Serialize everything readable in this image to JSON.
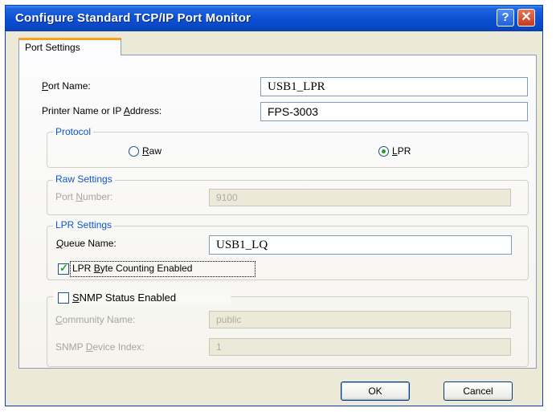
{
  "window": {
    "title": "Configure Standard TCP/IP Port Monitor",
    "help_label": "?",
    "close_label": "✕"
  },
  "tabs": [
    {
      "label": "Port Settings",
      "selected": true
    }
  ],
  "form": {
    "port_name": {
      "label_ul": "P",
      "label_rest": "ort Name:",
      "value": "USB1_LPR"
    },
    "printer": {
      "label_pre": "Printer Name or IP ",
      "label_ul": "A",
      "label_rest": "ddress:",
      "value": "FPS-3003"
    }
  },
  "protocol": {
    "legend": "Protocol",
    "raw": {
      "label_ul": "R",
      "label_rest": "aw",
      "selected": false
    },
    "lpr": {
      "label_ul": "L",
      "label_rest": "PR",
      "selected": true
    }
  },
  "raw_settings": {
    "legend": "Raw Settings",
    "port_number": {
      "label_pre": "Port ",
      "label_ul": "N",
      "label_rest": "umber:",
      "value": "9100"
    }
  },
  "lpr_settings": {
    "legend": "LPR Settings",
    "queue_name": {
      "label_ul": "Q",
      "label_rest": "ueue Name:",
      "value": "USB1_LQ"
    },
    "byte_counting": {
      "label_pre": "LPR ",
      "label_ul": "B",
      "label_rest": "yte Counting Enabled",
      "checked": true
    }
  },
  "snmp": {
    "status": {
      "label_ul": "S",
      "label_rest": "NMP Status Enabled",
      "checked": false
    },
    "community": {
      "label_ul": "C",
      "label_rest": "ommunity Name:",
      "value": "public"
    },
    "device_index": {
      "label_pre": "SNMP ",
      "label_ul": "D",
      "label_rest": "evice Index:",
      "value": "1"
    }
  },
  "buttons": {
    "ok": "OK",
    "cancel": "Cancel"
  },
  "colors": {
    "accent": "#0a4fd2",
    "legend": "#1155cc",
    "check": "#21a121",
    "tab_highlight": "#f7a31c"
  }
}
